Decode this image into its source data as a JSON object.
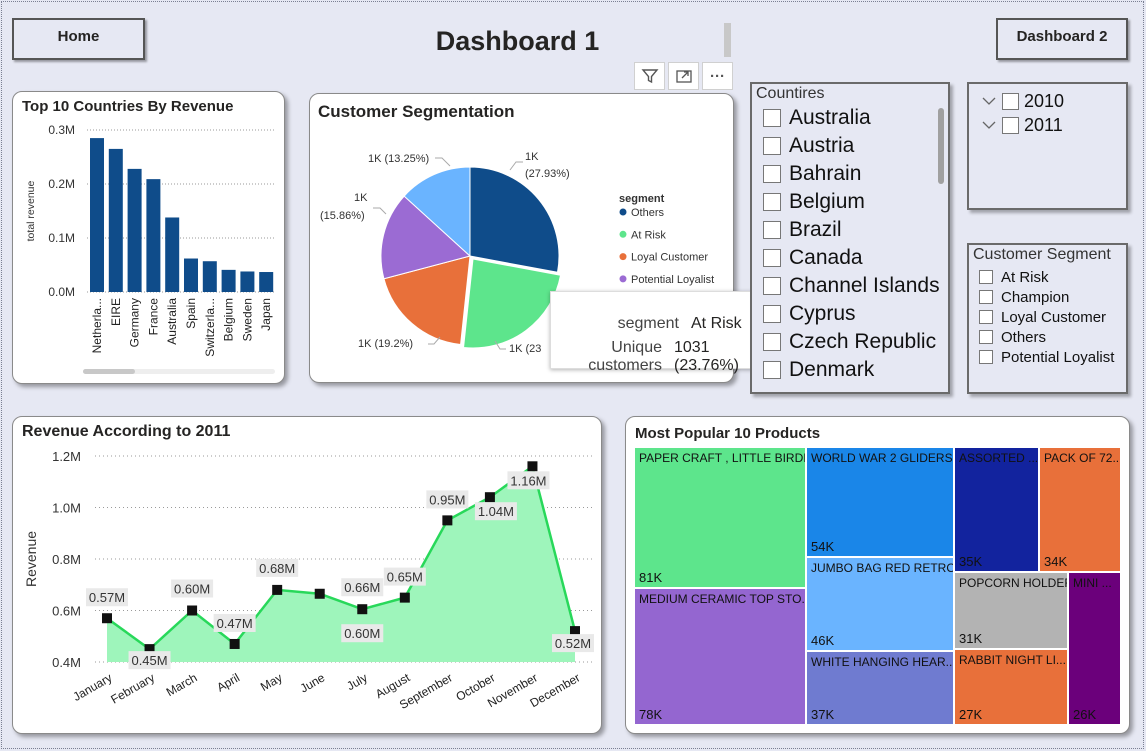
{
  "nav": {
    "home_label": "Home",
    "title": "Dashboard 1",
    "dashboard2_label": "Dashboard 2"
  },
  "visual_header": {
    "filter_icon": "filter-icon",
    "focus_icon": "focus-mode-icon",
    "more_label": "···"
  },
  "countries_card": {
    "title": "Top 10 Countries By Revenue",
    "chart_data": {
      "type": "bar",
      "categories": [
        "Netherla...",
        "EIRE",
        "Germany",
        "France",
        "Australia",
        "Spain",
        "Switzerla...",
        "Belgium",
        "Sweden",
        "Japan"
      ],
      "values": [
        285000,
        265000,
        228000,
        209000,
        138000,
        62000,
        57000,
        41000,
        38000,
        37000
      ],
      "ylabel": "total revenue",
      "yticks": [
        "0.0M",
        "0.1M",
        "0.2M",
        "0.3M"
      ],
      "ylim": [
        0,
        300000
      ],
      "color": "#0f4c8a"
    }
  },
  "segmentation_card": {
    "title": "Customer Segmentation",
    "chart_data": {
      "type": "pie",
      "legend_title": "segment",
      "slices": [
        {
          "name": "Others",
          "pct": 27.93,
          "label_lines": [
            "1K",
            "(27.93%)"
          ],
          "color": "#0f4c8a"
        },
        {
          "name": "At Risk",
          "pct": 23.76,
          "label_lines": [
            "1K (23"
          ],
          "color": "#5de58c"
        },
        {
          "name": "Loyal Customer",
          "pct": 19.2,
          "label_lines": [
            "1K (19.2%)"
          ],
          "color": "#e8703a"
        },
        {
          "name": "Potential Loyalist",
          "pct": 15.86,
          "label_lines": [
            "1K",
            "(15.86%)"
          ],
          "color": "#9b6bd3"
        },
        {
          "name": "",
          "pct": 13.25,
          "label_lines": [
            "1K (13.25%)"
          ],
          "color": "#6ab4ff"
        }
      ]
    },
    "legend": [
      {
        "label": "Others",
        "color": "#0f4c8a"
      },
      {
        "label": "At Risk",
        "color": "#5de58c"
      },
      {
        "label": "Loyal Customer",
        "color": "#e8703a"
      },
      {
        "label": "Potential Loyalist",
        "color": "#9b6bd3"
      }
    ],
    "tooltip": {
      "k1": "segment",
      "v1": "At Risk",
      "k2": "Unique customers",
      "v2": "1031 (23.76%)"
    }
  },
  "countries_slicer": {
    "title": "Countires",
    "items": [
      "Australia",
      "Austria",
      "Bahrain",
      "Belgium",
      "Brazil",
      "Canada",
      "Channel Islands",
      "Cyprus",
      "Czech Republic",
      "Denmark"
    ]
  },
  "year_slicer": {
    "items": [
      "2010",
      "2011"
    ]
  },
  "segment_slicer": {
    "title": "Customer Segment",
    "items": [
      "At Risk",
      "Champion",
      "Loyal Customer",
      "Others",
      "Potential Loyalist"
    ]
  },
  "revenue_card": {
    "title": "Revenue According to 2011",
    "chart_data": {
      "type": "area",
      "categories": [
        "January",
        "February",
        "March",
        "April",
        "May",
        "June",
        "July",
        "August",
        "September",
        "October",
        "November",
        "December"
      ],
      "values": [
        0.57,
        0.45,
        0.6,
        0.47,
        0.68,
        0.665,
        0.605,
        0.65,
        0.95,
        1.04,
        1.16,
        0.52
      ],
      "data_labels": [
        "0.57M",
        "0.45M",
        "0.60M",
        "0.47M",
        "0.68M",
        "",
        "0.66M",
        "0.65M",
        "0.95M",
        "1.04M",
        "1.16M",
        "0.52M"
      ],
      "extra_label": "0.60M",
      "ylabel": "Revenue",
      "yticks": [
        "0.4M",
        "0.6M",
        "0.8M",
        "1.0M",
        "1.2M"
      ],
      "ylim": [
        0.4,
        1.2
      ],
      "unit": "M"
    }
  },
  "products_card": {
    "title": "Most Popular 10 Products",
    "tiles": [
      {
        "label": "PAPER CRAFT , LITTLE BIRDIE",
        "value": "81K",
        "color": "#5de58c"
      },
      {
        "label": "MEDIUM CERAMIC TOP STO...",
        "value": "78K",
        "color": "#9466d0"
      },
      {
        "label": "WORLD WAR 2 GLIDERS...",
        "value": "54K",
        "color": "#1a86e8"
      },
      {
        "label": "JUMBO BAG RED RETRO...",
        "value": "46K",
        "color": "#6ab4ff"
      },
      {
        "label": "WHITE HANGING HEAR...",
        "value": "37K",
        "color": "#6f7bd0"
      },
      {
        "label": "ASSORTED ...",
        "value": "35K",
        "color": "#12239e"
      },
      {
        "label": "PACK OF 72...",
        "value": "34K",
        "color": "#e8703a"
      },
      {
        "label": "POPCORN HOLDER",
        "value": "31K",
        "color": "#b3b3b3"
      },
      {
        "label": "RABBIT NIGHT LI...",
        "value": "27K",
        "color": "#e8703a"
      },
      {
        "label": "MINI ...",
        "value": "26K",
        "color": "#6b007b"
      }
    ]
  }
}
